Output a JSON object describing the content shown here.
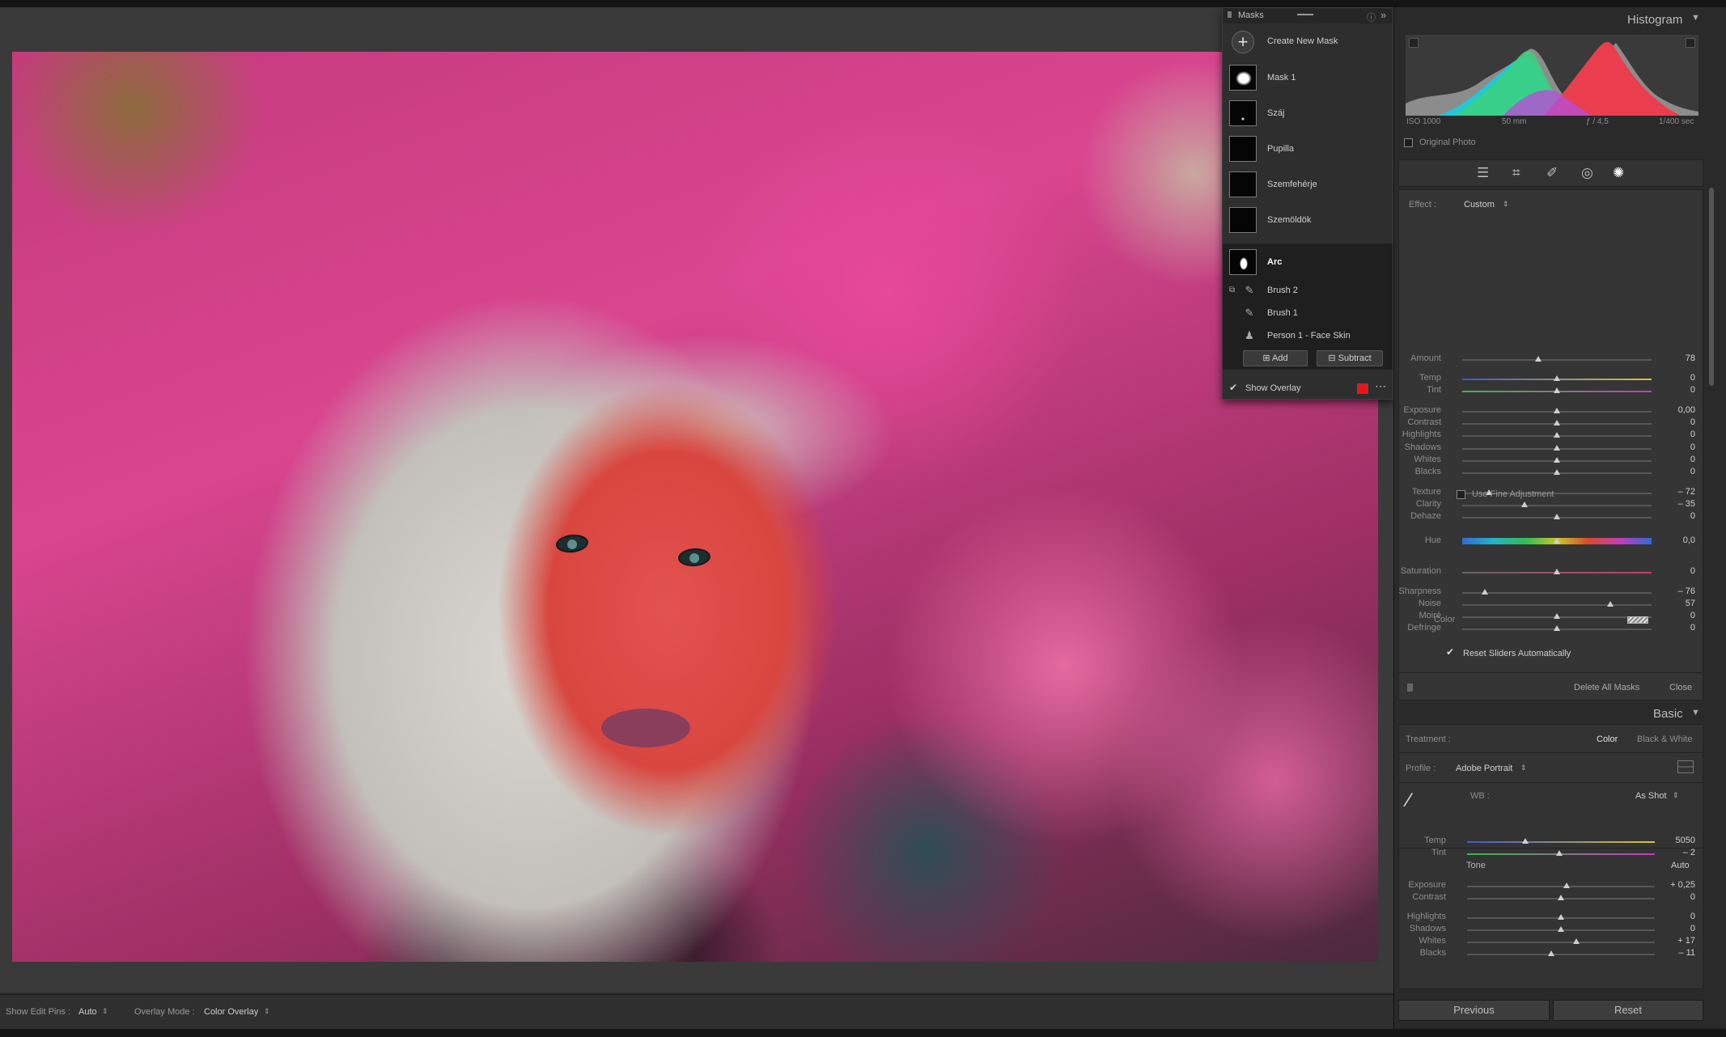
{
  "masks_panel": {
    "title": "Masks",
    "create_label": "Create New Mask",
    "items": [
      {
        "label": "Mask 1"
      },
      {
        "label": "Száj"
      },
      {
        "label": "Pupilla"
      },
      {
        "label": "Szemfehérje"
      },
      {
        "label": "Szemöldök"
      },
      {
        "label": "Arc"
      }
    ],
    "components": [
      {
        "label": "Brush 2"
      },
      {
        "label": "Brush 1"
      },
      {
        "label": "Person 1 - Face Skin"
      }
    ],
    "add_label": "Add",
    "subtract_label": "Subtract",
    "show_overlay_label": "Show Overlay",
    "overlay_color": "#e8161b"
  },
  "histogram": {
    "title": "Histogram",
    "iso": "ISO 1000",
    "focal": "50 mm",
    "aperture": "ƒ / 4,5",
    "shutter": "1/400 sec",
    "original_photo_label": "Original Photo"
  },
  "mask_effects": {
    "effect_label": "Effect :",
    "effect_value": "Custom",
    "sliders": [
      {
        "name": "amount",
        "label": "Amount",
        "value": "78",
        "pos": 0.4
      },
      {
        "name": "temp",
        "label": "Temp",
        "value": "0",
        "pos": 0.5
      },
      {
        "name": "tint",
        "label": "Tint",
        "value": "0",
        "pos": 0.5
      },
      {
        "name": "exposure",
        "label": "Exposure",
        "value": "0,00",
        "pos": 0.5
      },
      {
        "name": "contrast",
        "label": "Contrast",
        "value": "0",
        "pos": 0.5
      },
      {
        "name": "highlights",
        "label": "Highlights",
        "value": "0",
        "pos": 0.5
      },
      {
        "name": "shadows",
        "label": "Shadows",
        "value": "0",
        "pos": 0.5
      },
      {
        "name": "whites",
        "label": "Whites",
        "value": "0",
        "pos": 0.5
      },
      {
        "name": "blacks",
        "label": "Blacks",
        "value": "0",
        "pos": 0.5
      },
      {
        "name": "texture",
        "label": "Texture",
        "value": "– 72",
        "pos": 0.14
      },
      {
        "name": "clarity",
        "label": "Clarity",
        "value": "– 35",
        "pos": 0.33
      },
      {
        "name": "dehaze",
        "label": "Dehaze",
        "value": "0",
        "pos": 0.5
      },
      {
        "name": "hue",
        "label": "Hue",
        "value": "0,0",
        "pos": 0.5
      },
      {
        "name": "saturation",
        "label": "Saturation",
        "value": "0",
        "pos": 0.5
      },
      {
        "name": "sharpness",
        "label": "Sharpness",
        "value": "– 76",
        "pos": 0.12
      },
      {
        "name": "noise",
        "label": "Noise",
        "value": "57",
        "pos": 0.78
      },
      {
        "name": "moire",
        "label": "Moiré",
        "value": "0",
        "pos": 0.5
      },
      {
        "name": "defringe",
        "label": "Defringe",
        "value": "0",
        "pos": 0.5
      }
    ],
    "fine_adjust_label": "Use Fine Adjustment",
    "color_label": "Color",
    "reset_label": "Reset Sliders Automatically",
    "delete_all_label": "Delete All Masks",
    "close_label": "Close"
  },
  "basic": {
    "title": "Basic",
    "treatment_label": "Treatment :",
    "treatment_color": "Color",
    "treatment_bw": "Black & White",
    "profile_label": "Profile :",
    "profile_value": "Adobe Portrait",
    "wb_label": "WB :",
    "wb_value": "As Shot",
    "tone_label": "Tone",
    "auto_label": "Auto",
    "sliders": [
      {
        "name": "temp",
        "label": "Temp",
        "value": "5050",
        "pos": 0.31
      },
      {
        "name": "tint",
        "label": "Tint",
        "value": "– 2",
        "pos": 0.49
      },
      {
        "name": "exposure",
        "label": "Exposure",
        "value": "+ 0,25",
        "pos": 0.53
      },
      {
        "name": "contrast",
        "label": "Contrast",
        "value": "0",
        "pos": 0.5
      },
      {
        "name": "highlights",
        "label": "Highlights",
        "value": "0",
        "pos": 0.5
      },
      {
        "name": "shadows",
        "label": "Shadows",
        "value": "0",
        "pos": 0.5
      },
      {
        "name": "whites",
        "label": "Whites",
        "value": "+ 17",
        "pos": 0.58
      },
      {
        "name": "blacks",
        "label": "Blacks",
        "value": "– 11",
        "pos": 0.45
      }
    ]
  },
  "footer": {
    "previous_label": "Previous",
    "reset_label": "Reset"
  },
  "toolbar": {
    "show_pins_label": "Show Edit Pins :",
    "show_pins_value": "Auto",
    "overlay_mode_label": "Overlay Mode :",
    "overlay_mode_value": "Color Overlay"
  }
}
